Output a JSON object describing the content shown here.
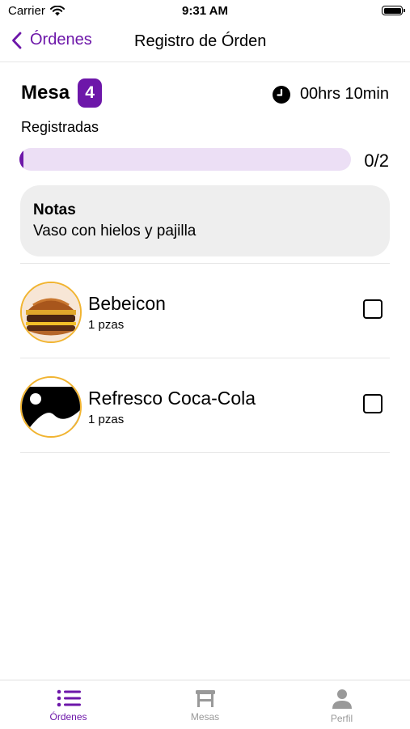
{
  "status_bar": {
    "carrier": "Carrier",
    "time": "9:31 AM"
  },
  "nav": {
    "back_label": "Órdenes",
    "title": "Registro de Órden"
  },
  "order": {
    "mesa_label": "Mesa",
    "mesa_number": "4",
    "timer": "00hrs 10min",
    "registered_label": "Registradas",
    "progress_text": "0/2",
    "progress_fraction": 0
  },
  "notes": {
    "title": "Notas",
    "text": "Vaso con hielos y pajilla"
  },
  "items": [
    {
      "name": "Bebeicon",
      "qty": "1 pzas",
      "checked": false,
      "image": "burger-photo"
    },
    {
      "name": "Refresco Coca-Cola",
      "qty": "1 pzas",
      "checked": false,
      "image": "placeholder-image-icon"
    }
  ],
  "tabs": [
    {
      "label": "Órdenes",
      "icon": "list-icon",
      "active": true
    },
    {
      "label": "Mesas",
      "icon": "table-icon",
      "active": false
    },
    {
      "label": "Perfil",
      "icon": "person-icon",
      "active": false
    }
  ],
  "colors": {
    "accent": "#6d17a9",
    "progress_track": "#ecdff5",
    "thumb_border": "#f1b431",
    "notes_bg": "#eeeeee"
  }
}
